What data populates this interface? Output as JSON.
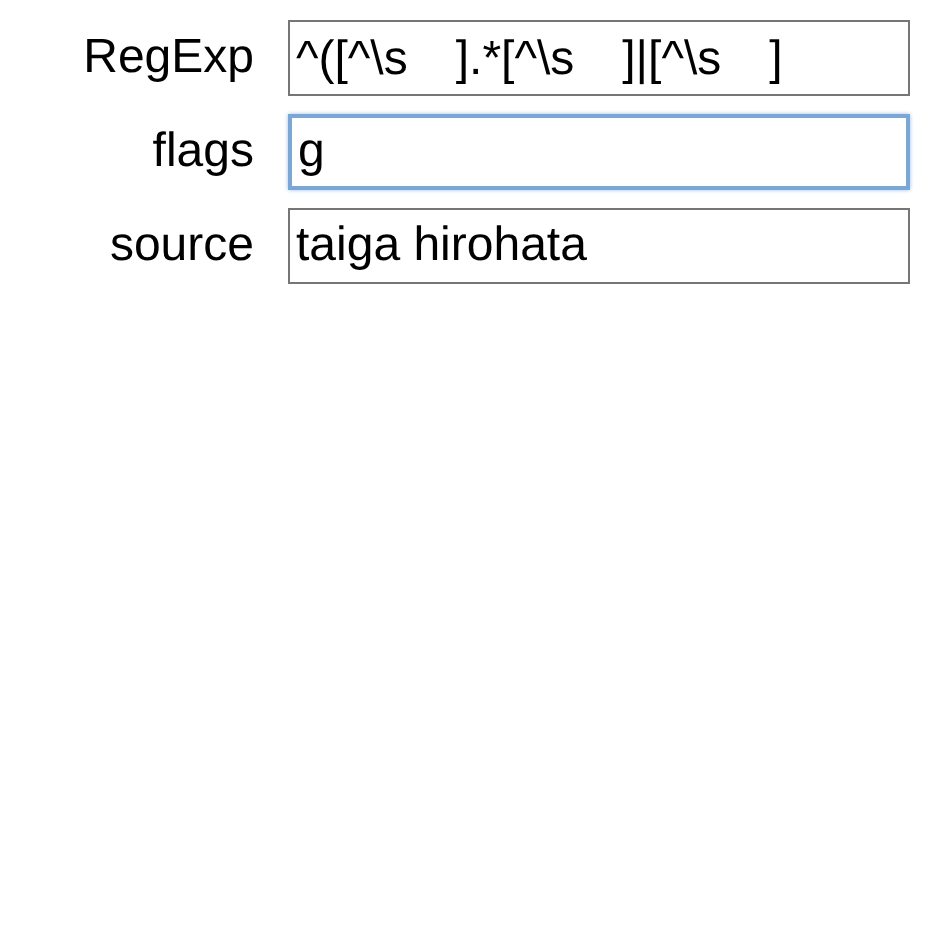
{
  "fields": [
    {
      "label": "RegExp",
      "value": "^([^\\s　].*[^\\s　]|[^\\s　]",
      "focused": false
    },
    {
      "label": "flags",
      "value": "g",
      "focused": true
    },
    {
      "label": "source",
      "value": "taiga hirohata",
      "focused": false
    }
  ]
}
